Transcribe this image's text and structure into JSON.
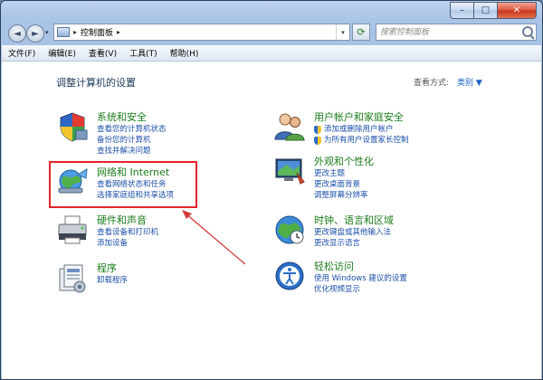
{
  "window": {
    "controls": {
      "minimize": "–",
      "maximize": "□",
      "close": "✕"
    }
  },
  "toolbar": {
    "back": "◄",
    "forward": "►",
    "address_sep": "▸",
    "address_text": "控制面板",
    "address_trail": "▸",
    "address_dropdown": "▾",
    "refresh": "⟳",
    "search_placeholder": "搜索控制面板"
  },
  "menubar": [
    {
      "label": "文件(F)"
    },
    {
      "label": "编辑(E)"
    },
    {
      "label": "查看(V)"
    },
    {
      "label": "工具(T)"
    },
    {
      "label": "帮助(H)"
    }
  ],
  "content": {
    "title": "调整计算机的设置",
    "view_by_label": "查看方式:",
    "view_by_value": "类别 ▼"
  },
  "categories_left": [
    {
      "icon": "security-shield-icon",
      "title": "系统和安全",
      "links": [
        "查看您的计算机状态",
        "备份您的计算机",
        "查找并解决问题"
      ]
    },
    {
      "icon": "network-globe-icon",
      "title": "网络和 Internet",
      "links": [
        "查看网络状态和任务",
        "选择家庭组和共享选项"
      ]
    },
    {
      "icon": "printer-icon",
      "title": "硬件和声音",
      "links": [
        "查看设备和打印机",
        "添加设备"
      ]
    },
    {
      "icon": "programs-icon",
      "title": "程序",
      "links": [
        "卸载程序"
      ]
    }
  ],
  "categories_right": [
    {
      "icon": "users-icon",
      "title": "用户帐户和家庭安全",
      "links": [
        "添加或删除用户帐户",
        "为所有用户设置家长控制"
      ],
      "shield_links": [
        0,
        1
      ]
    },
    {
      "icon": "appearance-monitor-icon",
      "title": "外观和个性化",
      "links": [
        "更改主题",
        "更改桌面背景",
        "调整屏幕分辨率"
      ],
      "shield_links": []
    },
    {
      "icon": "clock-globe-icon",
      "title": "时钟、语言和区域",
      "links": [
        "更改键盘或其他输入法",
        "更改显示语言"
      ],
      "shield_links": []
    },
    {
      "icon": "ease-of-access-icon",
      "title": "轻松访问",
      "links": [
        "使用 Windows 建议的设置",
        "优化视频显示"
      ],
      "shield_links": []
    }
  ],
  "colors": {
    "category_title": "#1b7c1b",
    "link": "#1a4fa8",
    "highlight": "#e4232b",
    "annotation_arrow": "#d23b3b"
  }
}
